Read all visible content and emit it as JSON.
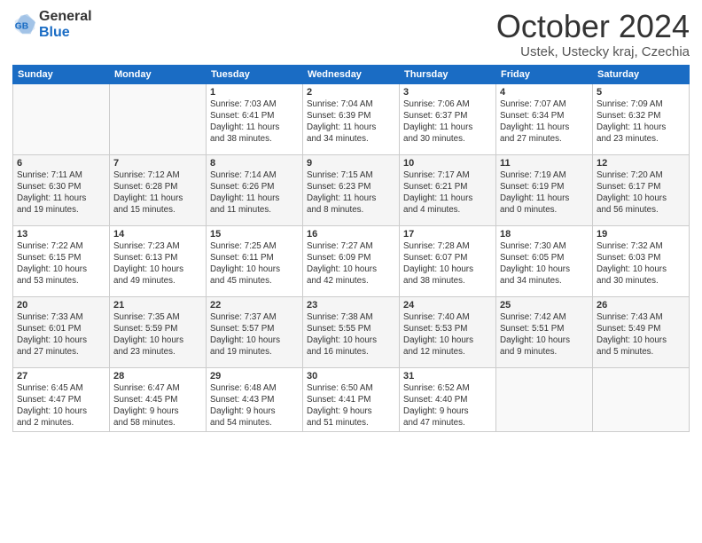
{
  "logo": {
    "general": "General",
    "blue": "Blue"
  },
  "title": "October 2024",
  "location": "Ustek, Ustecky kraj, Czechia",
  "days_of_week": [
    "Sunday",
    "Monday",
    "Tuesday",
    "Wednesday",
    "Thursday",
    "Friday",
    "Saturday"
  ],
  "weeks": [
    [
      {
        "day": "",
        "info": ""
      },
      {
        "day": "",
        "info": ""
      },
      {
        "day": "1",
        "info": "Sunrise: 7:03 AM\nSunset: 6:41 PM\nDaylight: 11 hours\nand 38 minutes."
      },
      {
        "day": "2",
        "info": "Sunrise: 7:04 AM\nSunset: 6:39 PM\nDaylight: 11 hours\nand 34 minutes."
      },
      {
        "day": "3",
        "info": "Sunrise: 7:06 AM\nSunset: 6:37 PM\nDaylight: 11 hours\nand 30 minutes."
      },
      {
        "day": "4",
        "info": "Sunrise: 7:07 AM\nSunset: 6:34 PM\nDaylight: 11 hours\nand 27 minutes."
      },
      {
        "day": "5",
        "info": "Sunrise: 7:09 AM\nSunset: 6:32 PM\nDaylight: 11 hours\nand 23 minutes."
      }
    ],
    [
      {
        "day": "6",
        "info": "Sunrise: 7:11 AM\nSunset: 6:30 PM\nDaylight: 11 hours\nand 19 minutes."
      },
      {
        "day": "7",
        "info": "Sunrise: 7:12 AM\nSunset: 6:28 PM\nDaylight: 11 hours\nand 15 minutes."
      },
      {
        "day": "8",
        "info": "Sunrise: 7:14 AM\nSunset: 6:26 PM\nDaylight: 11 hours\nand 11 minutes."
      },
      {
        "day": "9",
        "info": "Sunrise: 7:15 AM\nSunset: 6:23 PM\nDaylight: 11 hours\nand 8 minutes."
      },
      {
        "day": "10",
        "info": "Sunrise: 7:17 AM\nSunset: 6:21 PM\nDaylight: 11 hours\nand 4 minutes."
      },
      {
        "day": "11",
        "info": "Sunrise: 7:19 AM\nSunset: 6:19 PM\nDaylight: 11 hours\nand 0 minutes."
      },
      {
        "day": "12",
        "info": "Sunrise: 7:20 AM\nSunset: 6:17 PM\nDaylight: 10 hours\nand 56 minutes."
      }
    ],
    [
      {
        "day": "13",
        "info": "Sunrise: 7:22 AM\nSunset: 6:15 PM\nDaylight: 10 hours\nand 53 minutes."
      },
      {
        "day": "14",
        "info": "Sunrise: 7:23 AM\nSunset: 6:13 PM\nDaylight: 10 hours\nand 49 minutes."
      },
      {
        "day": "15",
        "info": "Sunrise: 7:25 AM\nSunset: 6:11 PM\nDaylight: 10 hours\nand 45 minutes."
      },
      {
        "day": "16",
        "info": "Sunrise: 7:27 AM\nSunset: 6:09 PM\nDaylight: 10 hours\nand 42 minutes."
      },
      {
        "day": "17",
        "info": "Sunrise: 7:28 AM\nSunset: 6:07 PM\nDaylight: 10 hours\nand 38 minutes."
      },
      {
        "day": "18",
        "info": "Sunrise: 7:30 AM\nSunset: 6:05 PM\nDaylight: 10 hours\nand 34 minutes."
      },
      {
        "day": "19",
        "info": "Sunrise: 7:32 AM\nSunset: 6:03 PM\nDaylight: 10 hours\nand 30 minutes."
      }
    ],
    [
      {
        "day": "20",
        "info": "Sunrise: 7:33 AM\nSunset: 6:01 PM\nDaylight: 10 hours\nand 27 minutes."
      },
      {
        "day": "21",
        "info": "Sunrise: 7:35 AM\nSunset: 5:59 PM\nDaylight: 10 hours\nand 23 minutes."
      },
      {
        "day": "22",
        "info": "Sunrise: 7:37 AM\nSunset: 5:57 PM\nDaylight: 10 hours\nand 19 minutes."
      },
      {
        "day": "23",
        "info": "Sunrise: 7:38 AM\nSunset: 5:55 PM\nDaylight: 10 hours\nand 16 minutes."
      },
      {
        "day": "24",
        "info": "Sunrise: 7:40 AM\nSunset: 5:53 PM\nDaylight: 10 hours\nand 12 minutes."
      },
      {
        "day": "25",
        "info": "Sunrise: 7:42 AM\nSunset: 5:51 PM\nDaylight: 10 hours\nand 9 minutes."
      },
      {
        "day": "26",
        "info": "Sunrise: 7:43 AM\nSunset: 5:49 PM\nDaylight: 10 hours\nand 5 minutes."
      }
    ],
    [
      {
        "day": "27",
        "info": "Sunrise: 6:45 AM\nSunset: 4:47 PM\nDaylight: 10 hours\nand 2 minutes."
      },
      {
        "day": "28",
        "info": "Sunrise: 6:47 AM\nSunset: 4:45 PM\nDaylight: 9 hours\nand 58 minutes."
      },
      {
        "day": "29",
        "info": "Sunrise: 6:48 AM\nSunset: 4:43 PM\nDaylight: 9 hours\nand 54 minutes."
      },
      {
        "day": "30",
        "info": "Sunrise: 6:50 AM\nSunset: 4:41 PM\nDaylight: 9 hours\nand 51 minutes."
      },
      {
        "day": "31",
        "info": "Sunrise: 6:52 AM\nSunset: 4:40 PM\nDaylight: 9 hours\nand 47 minutes."
      },
      {
        "day": "",
        "info": ""
      },
      {
        "day": "",
        "info": ""
      }
    ]
  ]
}
